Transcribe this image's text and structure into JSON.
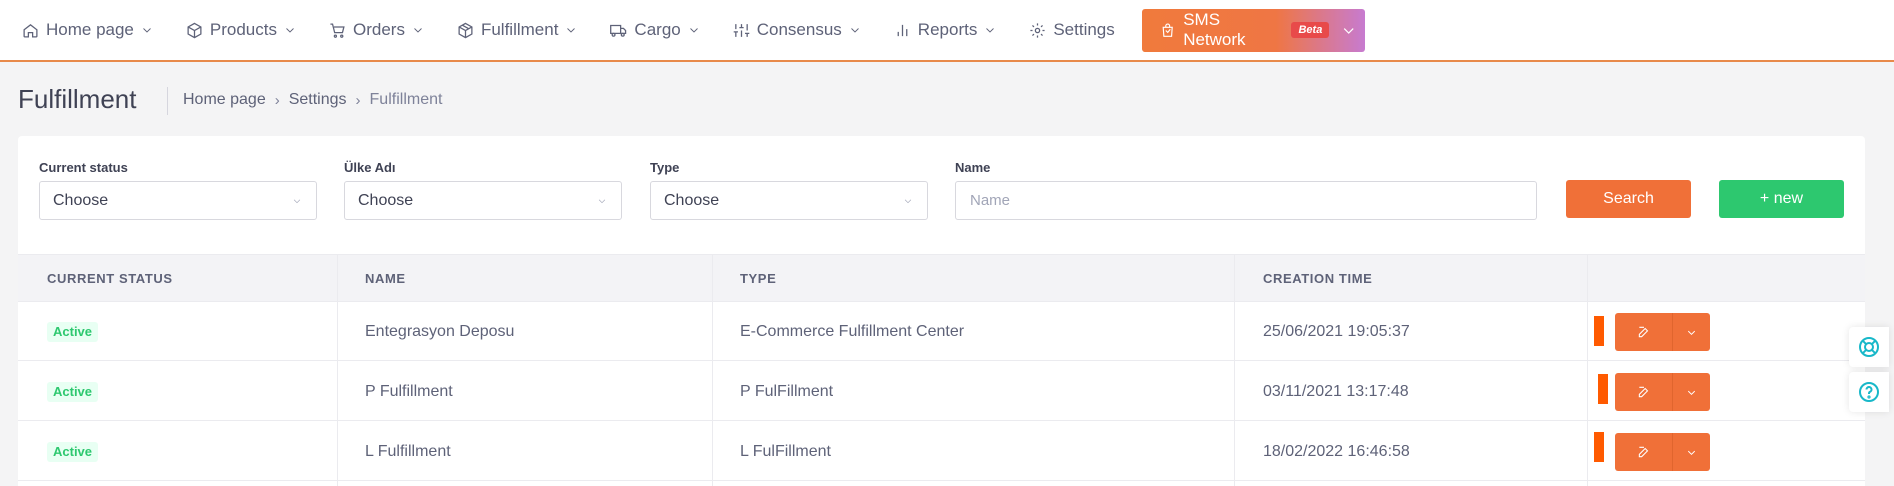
{
  "nav": {
    "items": [
      {
        "label": "Home page",
        "icon": "home-icon"
      },
      {
        "label": "Products",
        "icon": "box-icon"
      },
      {
        "label": "Orders",
        "icon": "cart-icon"
      },
      {
        "label": "Fulfillment",
        "icon": "cube-icon"
      },
      {
        "label": "Cargo",
        "icon": "truck-icon"
      },
      {
        "label": "Consensus",
        "icon": "sliders-icon"
      },
      {
        "label": "Reports",
        "icon": "bar-chart-icon"
      },
      {
        "label": "Settings",
        "icon": "gear-icon"
      }
    ],
    "sms": {
      "label": "SMS Network",
      "badge": "Beta"
    }
  },
  "page": {
    "title": "Fulfillment",
    "breadcrumb": [
      "Home page",
      "Settings",
      "Fulfillment"
    ]
  },
  "filters": {
    "status": {
      "label": "Current status",
      "value": "Choose"
    },
    "country": {
      "label": "Ülke Adı",
      "value": "Choose"
    },
    "type": {
      "label": "Type",
      "value": "Choose"
    },
    "name": {
      "label": "Name",
      "placeholder": "Name"
    },
    "search_label": "Search",
    "new_label": "+ new"
  },
  "table": {
    "headers": [
      "CURRENT STATUS",
      "NAME",
      "TYPE",
      "CREATION TIME"
    ],
    "rows": [
      {
        "status": "Active",
        "name": "Entegrasyon Deposu",
        "type": "E-Commerce Fulfillment Center",
        "created": "25/06/2021 19:05:37"
      },
      {
        "status": "Active",
        "name": "P Fulfillment",
        "type": "P FulFillment",
        "created": "03/11/2021 13:17:48"
      },
      {
        "status": "Active",
        "name": "L Fulfillment",
        "type": "L FulFillment",
        "created": "18/02/2022 16:46:58"
      }
    ]
  },
  "colors": {
    "accent": "#f07038",
    "success": "#2dc86f",
    "status_mark": "#ff5a00",
    "help": "#18b8c9"
  }
}
